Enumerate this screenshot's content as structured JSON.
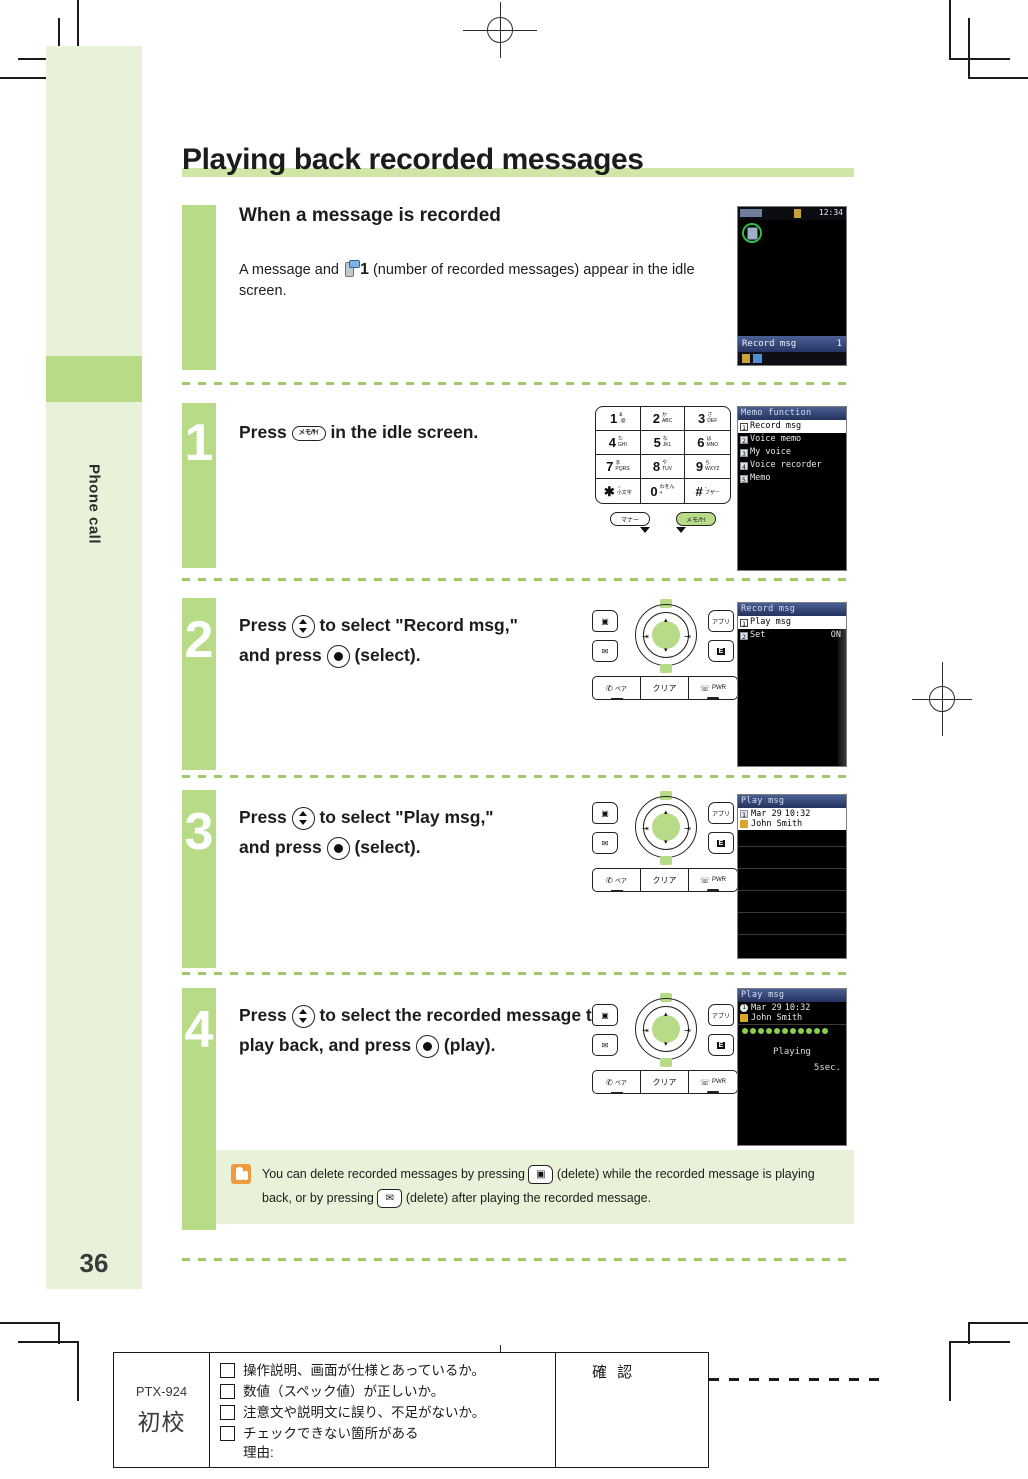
{
  "page": {
    "title": "Playing back recorded messages",
    "side_tab_label": "Phone call",
    "page_number": "36"
  },
  "intro": {
    "heading": "When a message is recorded",
    "text_before_icon": "A message and",
    "count_glyph": "1",
    "text_after_icon": "(number of recorded messages) appear in the idle screen.",
    "icon": "recorded-message-icon"
  },
  "steps": [
    {
      "number": "1",
      "text_parts": [
        "Press",
        "in the idle screen."
      ],
      "key_label": "メモ/ｻｲ",
      "key_icon": "memo-key"
    },
    {
      "number": "2",
      "text_parts": [
        "Press",
        "to select \"Record msg,\"",
        "and press",
        "(select)."
      ],
      "keys": [
        "up-down-key",
        "center-select-key"
      ]
    },
    {
      "number": "3",
      "text_parts": [
        "Press",
        "to select \"Play msg,\"",
        "and press",
        "(select)."
      ],
      "keys": [
        "up-down-key",
        "center-select-key"
      ]
    },
    {
      "number": "4",
      "text_parts": [
        "Press",
        "to select the recorded message to play back, and press",
        "(play)."
      ],
      "keys": [
        "up-down-key",
        "center-select-key"
      ]
    }
  ],
  "screens": {
    "idle": {
      "status_time": "12:34",
      "footer_label": "Record msg",
      "footer_count": "1"
    },
    "memo_function": {
      "title": "Memo function",
      "items": [
        {
          "num": "1",
          "label": "Record msg",
          "selected": true
        },
        {
          "num": "2",
          "label": "Voice memo",
          "selected": false
        },
        {
          "num": "3",
          "label": "My voice",
          "selected": false
        },
        {
          "num": "4",
          "label": "Voice recorder",
          "selected": false
        },
        {
          "num": "5",
          "label": "Memo",
          "selected": false
        }
      ]
    },
    "record_msg": {
      "title": "Record msg",
      "items": [
        {
          "num": "1",
          "label": "Play msg",
          "value": "",
          "selected": true
        },
        {
          "num": "2",
          "label": "Set",
          "value": "ON",
          "selected": false
        }
      ]
    },
    "play_msg_list": {
      "title": "Play msg",
      "entry_num": "1",
      "entry_date": "Mar 29",
      "entry_time": "10:32",
      "entry_name": "John Smith"
    },
    "play_msg_playing": {
      "title": "Play msg",
      "entry_num": "1",
      "entry_date": "Mar 29",
      "entry_time": "10:32",
      "entry_name": "John Smith",
      "status": "Playing",
      "elapsed": "5sec.",
      "dot_count": 11
    }
  },
  "keypad": {
    "keys": [
      {
        "big": "1",
        "top": "&",
        "bottom": ".@"
      },
      {
        "big": "2",
        "top": "か",
        "bottom": "ABC"
      },
      {
        "big": "3",
        "top": "さ",
        "bottom": "DEF"
      },
      {
        "big": "4",
        "top": "た",
        "bottom": "GHI"
      },
      {
        "big": "5",
        "top": "な",
        "bottom": "JKL"
      },
      {
        "big": "6",
        "top": "は",
        "bottom": "MNO"
      },
      {
        "big": "7",
        "top": "ま",
        "bottom": "PQRS"
      },
      {
        "big": "8",
        "top": "や",
        "bottom": "TUV"
      },
      {
        "big": "9",
        "top": "ら",
        "bottom": "WXYZ"
      },
      {
        "big": "✱",
        "top": "⇔",
        "bottom": "小文字"
      },
      {
        "big": "0",
        "top": "わをん",
        "bottom": "+"
      },
      {
        "big": "#",
        "top": "、",
        "bottom": "ブザー"
      }
    ],
    "soft_left": "マナー",
    "soft_right": "メモ/ｻｲ"
  },
  "navkeys": {
    "left_top": "phonebook-key",
    "left_bottom": "mail-key",
    "right_top": "アプリ",
    "right_bottom": "E",
    "bottom": [
      {
        "label": "ペア",
        "icon": "call-key"
      },
      {
        "label": "クリア",
        "icon": "clear-key"
      },
      {
        "label": "PWR",
        "icon": "power-key"
      }
    ]
  },
  "note": {
    "icon": "hand-pointer-icon",
    "line1_a": "You can delete recorded messages by pressing",
    "line1_b": "(delete) while the recorded message",
    "line2_a": "is playing back, or by pressing",
    "line2_b": "(delete) after playing the recorded message."
  },
  "proof_stamp": {
    "code": "PTX-924",
    "stamp": "初校",
    "confirm_label": "確 認",
    "checklist": [
      "操作説明、画面が仕様とあっているか。",
      "数値（スペック値）が正しいか。",
      "注意文や説明文に誤り、不足がないか。",
      "チェックできない箇所がある",
      "理由:"
    ]
  },
  "colors": {
    "accent_green": "#b7db86",
    "tint_green": "#e7f2d8",
    "rule_green": "#cfe6a6",
    "lcd_title_blue": "#2b3f72",
    "note_orange": "#f09a3e"
  }
}
